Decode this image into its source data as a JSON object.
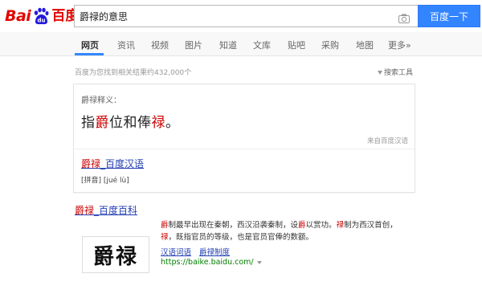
{
  "header": {
    "logo": {
      "bai": "Bai",
      "du": "du",
      "cn": "百度"
    },
    "search_value": "爵禄的意思",
    "search_button": "百度一下",
    "accent_color": "#3385ff"
  },
  "tabs": [
    {
      "label": "网页",
      "active": true
    },
    {
      "label": "资讯"
    },
    {
      "label": "视频"
    },
    {
      "label": "图片"
    },
    {
      "label": "知道"
    },
    {
      "label": "文库"
    },
    {
      "label": "贴吧"
    },
    {
      "label": "采购"
    },
    {
      "label": "地图"
    },
    {
      "label": "更多»"
    }
  ],
  "result_stats": "百度为您找到相关结果约432,000个",
  "search_tools": "搜索工具",
  "dictionary_card": {
    "header": "爵禄释义：",
    "definition": {
      "prefix": "指",
      "hl1": "爵",
      "middle": "位和俸",
      "hl2": "禄",
      "suffix": "。"
    },
    "source": "来自百度汉语",
    "link": {
      "hl": "爵禄",
      "rest": "_百度汉语"
    },
    "pinyin": "[拼音] [jué lù]"
  },
  "baike": {
    "title": {
      "hl": "爵禄",
      "rest": "_百度百科"
    },
    "image_text": "爵禄",
    "text": {
      "s1": "爵",
      "s2": "制最早出现在秦朝，西汉沿袭秦制，设",
      "s3": "爵",
      "s4": "以赏功。",
      "s5": "禄",
      "s6": "制为西汉首创，",
      "s7": "禄",
      "s8": "，既指官员的等级，也是官员官俸的数额。"
    },
    "links": [
      "汉语词语",
      "爵禄制度"
    ],
    "url": "https://baike.baidu.com/"
  }
}
